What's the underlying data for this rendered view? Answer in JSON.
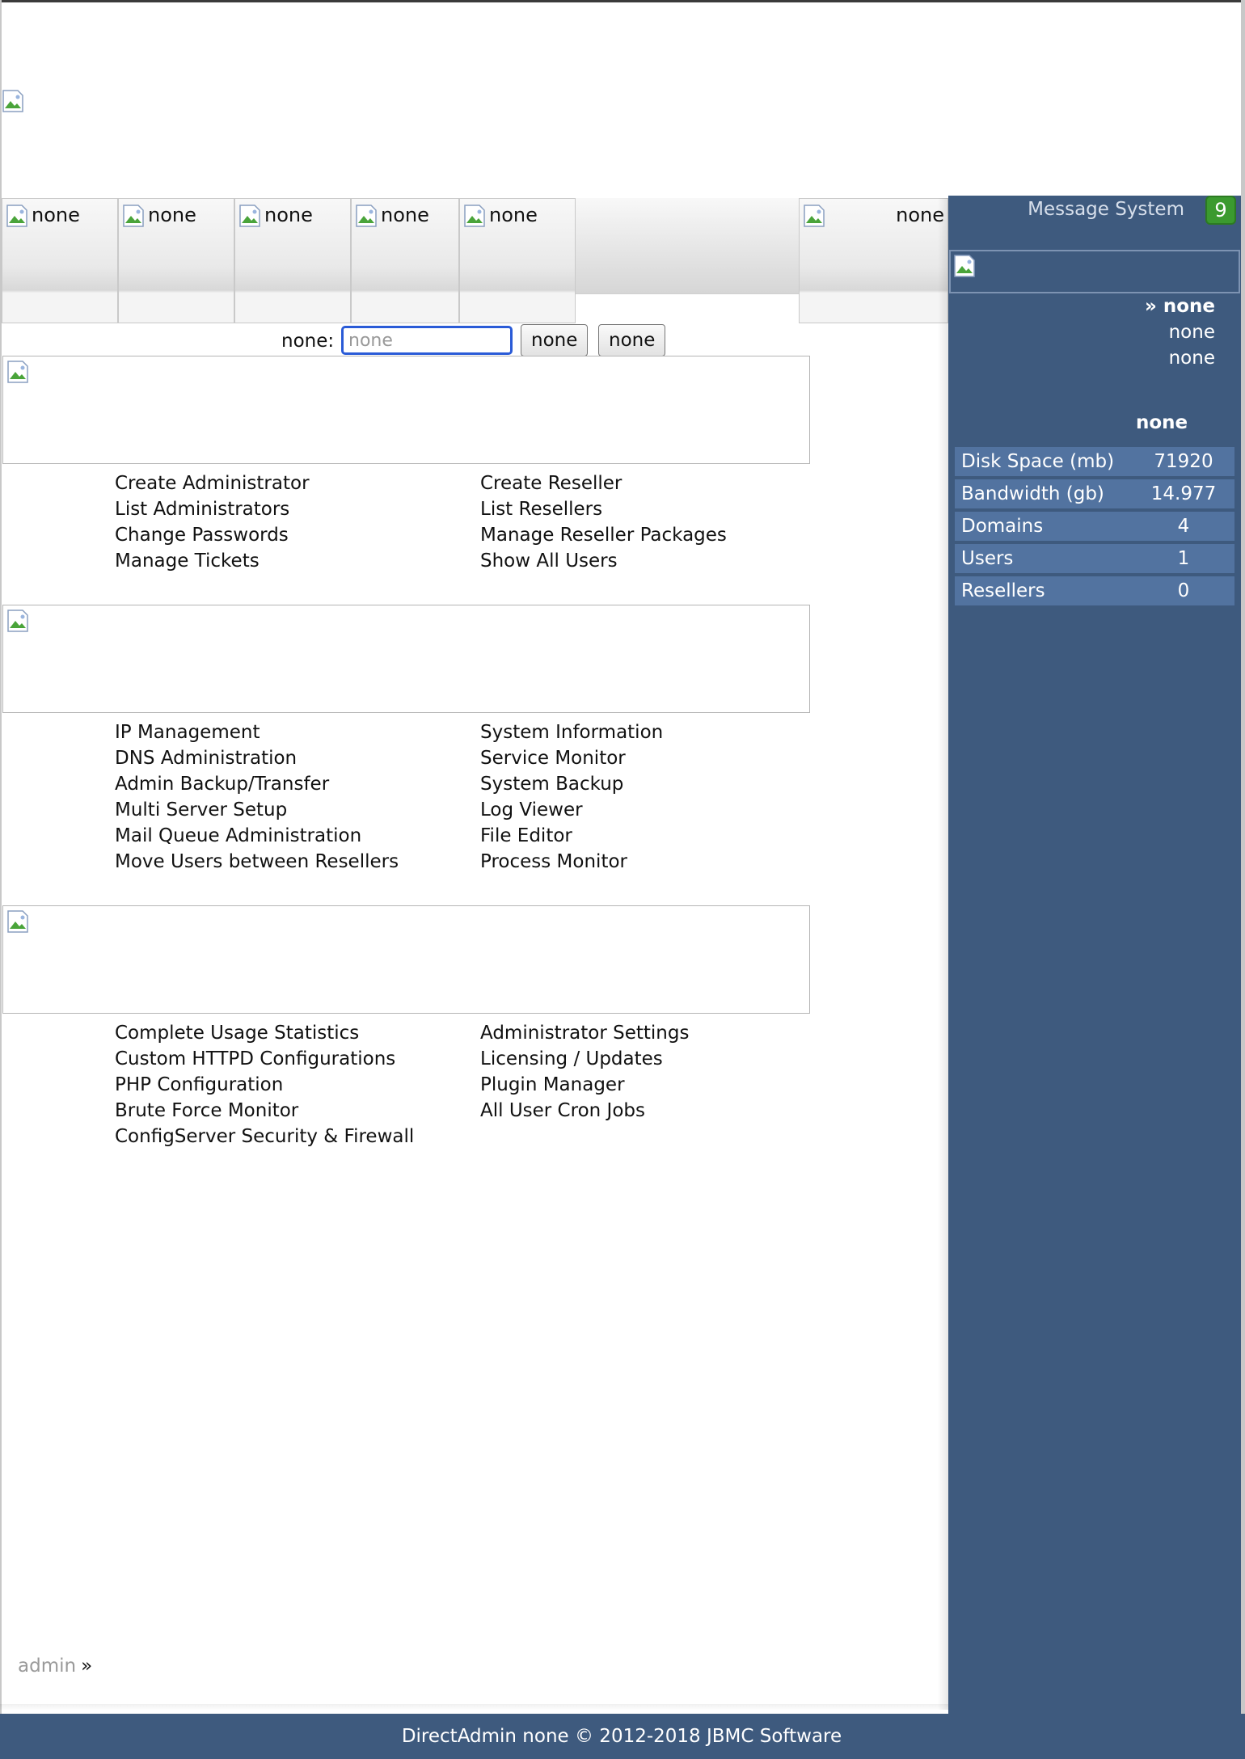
{
  "tabs": [
    {
      "label": "none"
    },
    {
      "label": "none"
    },
    {
      "label": "none"
    },
    {
      "label": "none"
    },
    {
      "label": "none"
    }
  ],
  "tab_right": {
    "label": "none"
  },
  "search": {
    "label": "none:",
    "placeholder": "none",
    "button1": "none",
    "button2": "none"
  },
  "sections": [
    {
      "left": [
        "Create Administrator",
        "List Administrators",
        "Change Passwords",
        "Manage Tickets"
      ],
      "right": [
        "Create Reseller",
        "List Resellers",
        "Manage Reseller Packages",
        "Show All Users"
      ]
    },
    {
      "left": [
        "IP Management",
        "DNS Administration",
        "Admin Backup/Transfer",
        "Multi Server Setup",
        "Mail Queue Administration",
        "Move Users between Resellers"
      ],
      "right": [
        "System Information",
        "Service Monitor",
        "System Backup",
        "Log Viewer",
        "File Editor",
        "Process Monitor"
      ]
    },
    {
      "left": [
        "Complete Usage Statistics",
        "Custom HTTPD Configurations",
        "PHP Configuration",
        "Brute Force Monitor",
        "ConfigServer Security & Firewall"
      ],
      "right": [
        "Administrator Settings",
        "Licensing / Updates",
        "Plugin Manager",
        "All User Cron Jobs"
      ]
    }
  ],
  "breadcrumb": {
    "user": "admin",
    "separator": "»"
  },
  "sidebar": {
    "message_label": "Message System",
    "message_count": "9",
    "links": [
      "» none",
      "none",
      "none"
    ],
    "stats_title": "none",
    "stats": [
      {
        "label": "Disk Space (mb)",
        "value": "71920"
      },
      {
        "label": "Bandwidth (gb)",
        "value": "14.977"
      },
      {
        "label": "Domains",
        "value": "4"
      },
      {
        "label": "Users",
        "value": "1"
      },
      {
        "label": "Resellers",
        "value": "0"
      }
    ]
  },
  "footer": {
    "text": "DirectAdmin none © 2012-2018 JBMC Software"
  },
  "colors": {
    "sidebar_bg": "#3e5a7e",
    "stat_row_bg": "#5273a0",
    "badge_green": "#3b9a2f",
    "input_focus": "#2a5bd7"
  }
}
